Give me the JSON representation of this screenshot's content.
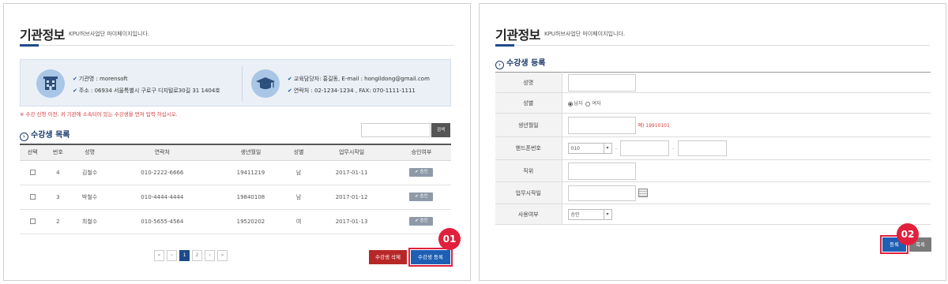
{
  "left": {
    "title": "기관정보",
    "subtitle": "KPU허브사업단 마이페이지입니다.",
    "info": {
      "org_name": "기관명 : morensoft",
      "address": "주소 : 06934 서울특별시 구로구 디지털로30길 31 1404호",
      "manager": "교육담당자: 홍길동, E-mail : hongildong@gmail.com",
      "contact": "연락처 : 02-1234-1234 , FAX: 070-1111-1111",
      "check_mark": "✔"
    },
    "notice": "※ 수강 신청 이전, 귀 기관에 소속되어 있는 수강생을 먼저 입력 하십시오.",
    "section_title": "수강생 목록",
    "search_button": "검색",
    "table": {
      "headers": [
        "선택",
        "번호",
        "성명",
        "연락처",
        "생년월일",
        "성별",
        "업무시작일",
        "승인여부"
      ],
      "rows": [
        {
          "no": "4",
          "name": "김철수",
          "phone": "010-2222-6666",
          "birth": "19411219",
          "gender": "남",
          "start": "2017-01-11",
          "status": "✔ 승인"
        },
        {
          "no": "3",
          "name": "박철수",
          "phone": "010-4444-4444",
          "birth": "19840108",
          "gender": "남",
          "start": "2017-01-12",
          "status": "✔ 승인"
        },
        {
          "no": "2",
          "name": "최철수",
          "phone": "010-5655-4564",
          "birth": "19520202",
          "gender": "여",
          "start": "2017-01-13",
          "status": "✔ 승인"
        }
      ]
    },
    "pagination": {
      "first": "«",
      "prev": "‹",
      "pages": [
        "1",
        "2"
      ],
      "next": "›",
      "last": "»"
    },
    "delete_button": "수강생 삭제",
    "register_button": "수강생 등록",
    "step_badge": "01"
  },
  "right": {
    "title": "기관정보",
    "subtitle": "KPU허브사업단 마이페이지입니다.",
    "section_title": "수강생 등록",
    "form": {
      "name_label": "성명",
      "gender_label": "성별",
      "gender_male": "남자",
      "gender_female": "여자",
      "birth_label": "생년월일",
      "birth_example": "예) 19910101",
      "phone_label": "핸드폰번호",
      "phone_prefix": "010",
      "phone_dash": "-",
      "position_label": "직위",
      "start_label": "업무시작일",
      "status_label": "사용여부",
      "status_value": "승인",
      "select_arrow": "▾"
    },
    "register_button": "등록",
    "list_button": "목록",
    "step_badge": "02"
  },
  "colors": {
    "accent": "#1e4a8a",
    "highlight": "#e0203c",
    "delete": "#b82727",
    "notice": "#d23c3c"
  }
}
